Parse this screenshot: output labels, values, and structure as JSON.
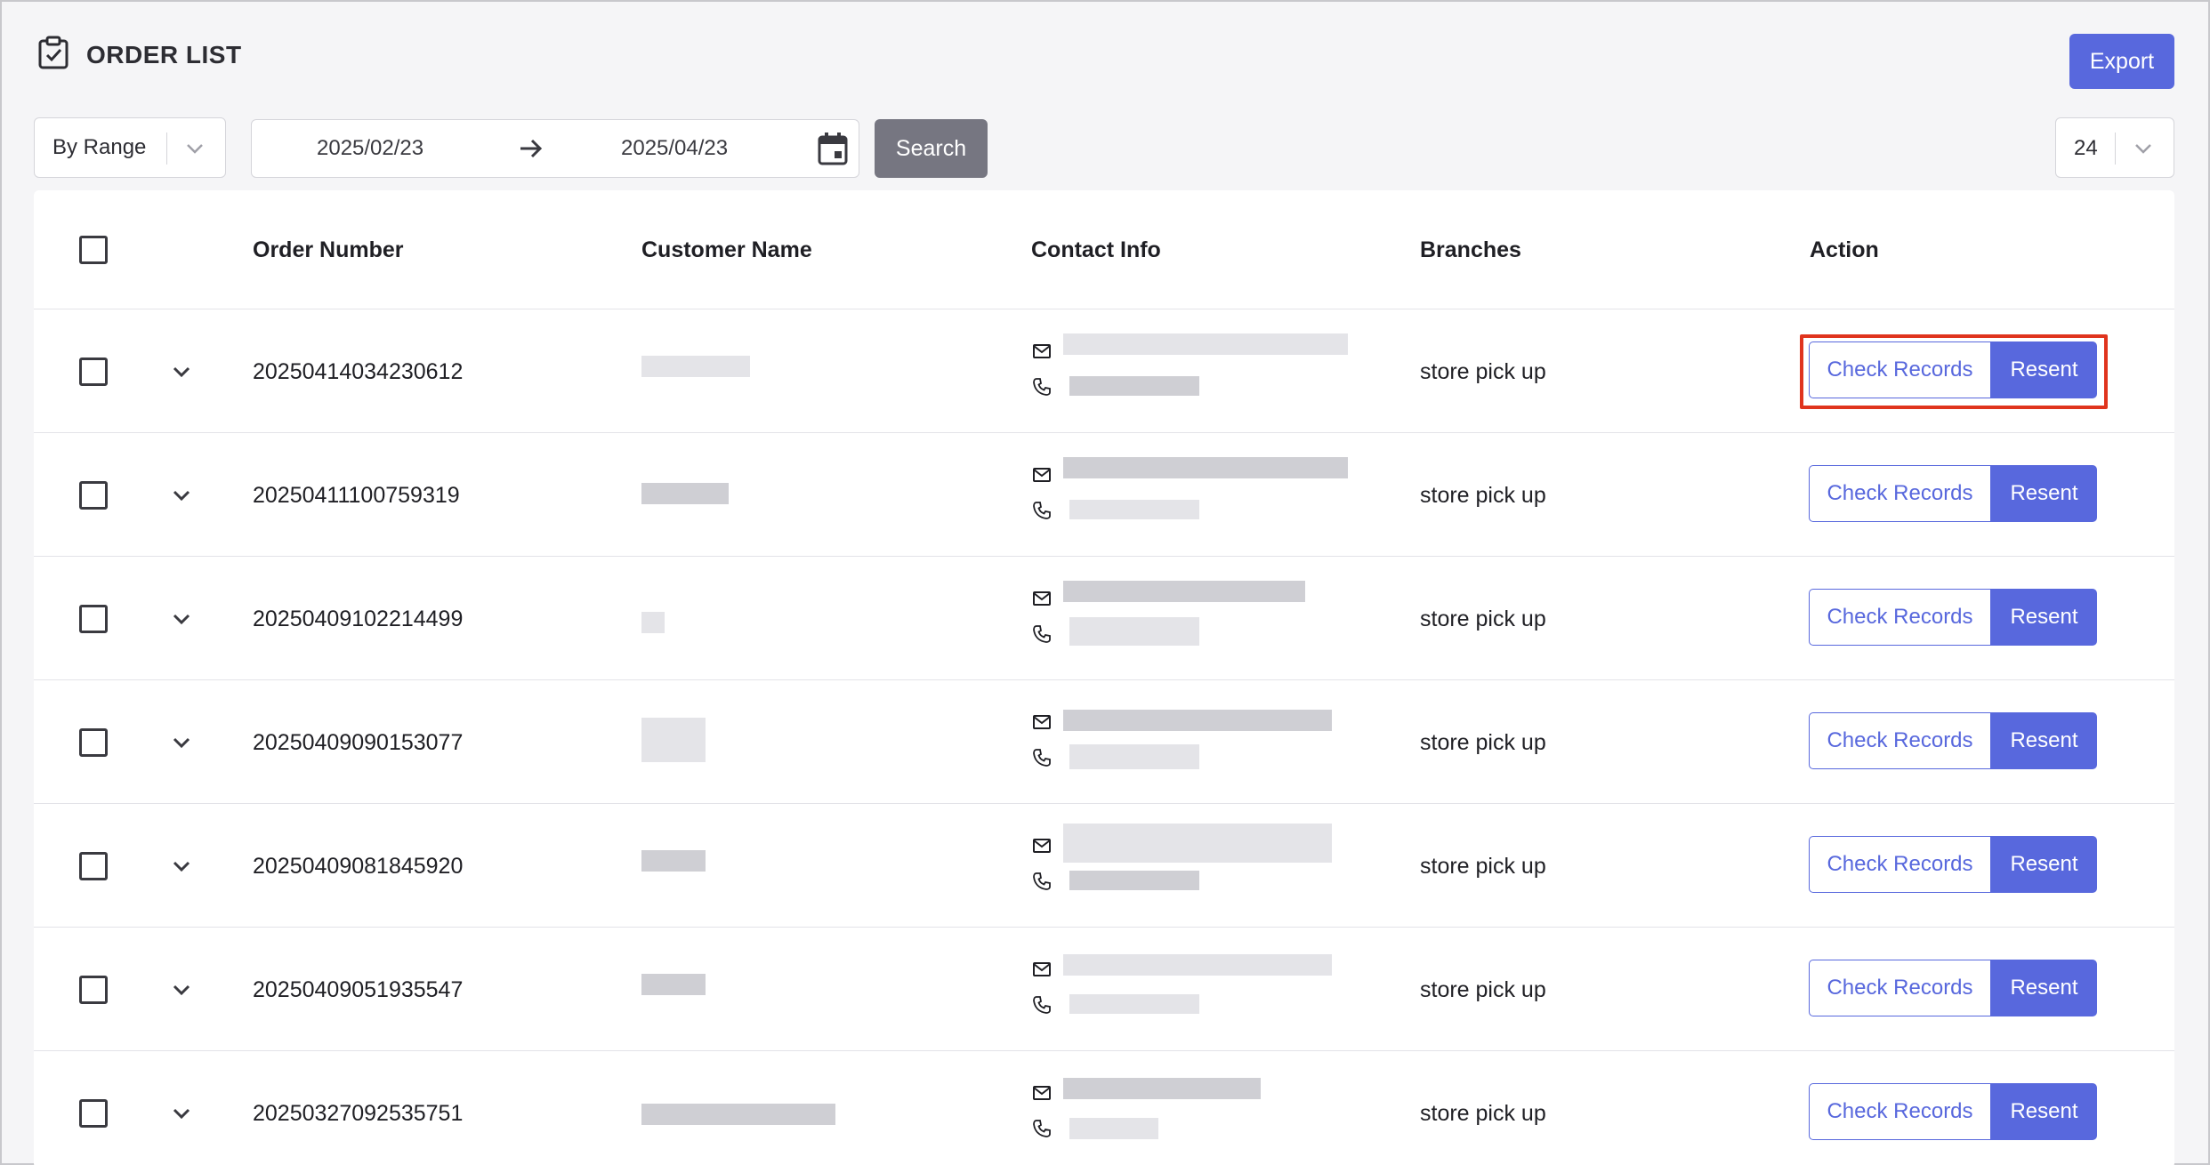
{
  "header": {
    "title": "ORDER LIST",
    "export_label": "Export",
    "icon": "clipboard-check-icon"
  },
  "filters": {
    "range_mode": "By Range",
    "start_date": "2025/02/23",
    "end_date": "2025/04/23",
    "search_label": "Search",
    "page_size": "24"
  },
  "table": {
    "columns": [
      "Order Number",
      "Customer Name",
      "Contact Info",
      "Branches",
      "Action"
    ],
    "rows": [
      {
        "order_number": "20250414034230612",
        "branch": "store pick up",
        "check_label": "Check Records",
        "resent_label": "Resent"
      },
      {
        "order_number": "20250411100759319",
        "branch": "store pick up",
        "check_label": "Check Records",
        "resent_label": "Resent"
      },
      {
        "order_number": "20250409102214499",
        "branch": "store pick up",
        "check_label": "Check Records",
        "resent_label": "Resent"
      },
      {
        "order_number": "20250409090153077",
        "branch": "store pick up",
        "check_label": "Check Records",
        "resent_label": "Resent"
      },
      {
        "order_number": "20250409081845920",
        "branch": "store pick up",
        "check_label": "Check Records",
        "resent_label": "Resent"
      },
      {
        "order_number": "20250409051935547",
        "branch": "store pick up",
        "check_label": "Check Records",
        "resent_label": "Resent"
      },
      {
        "order_number": "20250327092535751",
        "branch": "store pick up",
        "check_label": "Check Records",
        "resent_label": "Resent"
      }
    ]
  },
  "colors": {
    "accent": "#5868dd",
    "search_button": "#767681",
    "highlight": "#e0341d"
  }
}
